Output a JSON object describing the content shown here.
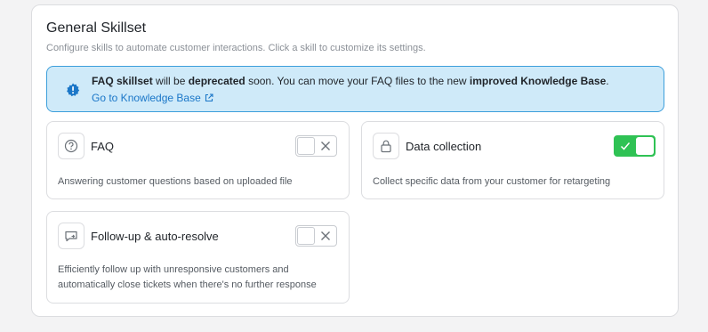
{
  "section": {
    "title": "General Skillset",
    "subtitle": "Configure skills to automate customer interactions. Click a skill to customize its settings."
  },
  "banner": {
    "part1": "FAQ skillset",
    "part2": " will be ",
    "part3": "deprecated",
    "part4": " soon. You can move your FAQ files to the new ",
    "part5": "improved Knowledge Base",
    "part6": ".",
    "link_label": "Go to Knowledge Base",
    "icon": "info-badge-icon"
  },
  "skills": [
    {
      "title": "FAQ",
      "description": "Answering customer questions based on uploaded file",
      "enabled": false,
      "icon": "question-circle-icon"
    },
    {
      "title": "Data collection",
      "description": "Collect specific data from your customer for retargeting",
      "enabled": true,
      "icon": "lock-icon"
    },
    {
      "title": "Follow-up & auto-resolve",
      "description_line1": "Efficiently follow up with unresponsive customers and",
      "description_line2": "automatically close tickets when there's no further response",
      "enabled": false,
      "icon": "chat-forward-icon"
    }
  ],
  "colors": {
    "accent": "#1b77c8",
    "toggle_on": "#2fc254",
    "banner_bg": "#cfeaf9",
    "banner_border": "#3d9fdb"
  }
}
